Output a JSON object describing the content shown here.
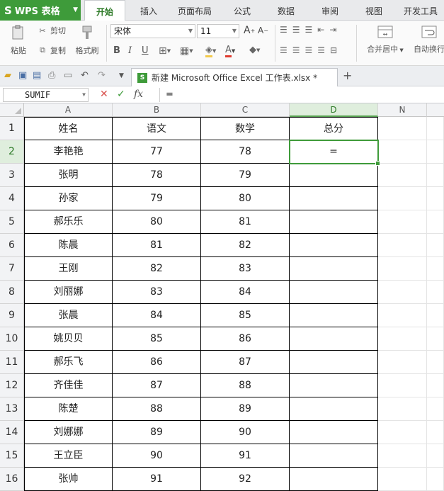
{
  "app": {
    "name": "WPS 表格",
    "logo": "S"
  },
  "tabs": [
    "开始",
    "插入",
    "页面布局",
    "公式",
    "数据",
    "审阅",
    "视图",
    "开发工具"
  ],
  "active_tab": "开始",
  "ribbon": {
    "cut_label": "剪切",
    "copy_label": "复制",
    "paste_label": "粘贴",
    "format_painter_label": "格式刷",
    "font_name": "宋体",
    "font_size": "11",
    "merge_center_label": "合并居中",
    "wrap_text_label": "自动换行"
  },
  "document": {
    "tab_title": "新建 Microsoft Office Excel 工作表.xlsx *",
    "icon": "excel-icon"
  },
  "formula_bar": {
    "name_box": "SUMIF",
    "formula": "="
  },
  "columns": [
    "A",
    "B",
    "C",
    "D",
    "N"
  ],
  "selected_column": "D",
  "selected_row": 2,
  "sheet": {
    "headers": [
      "姓名",
      "语文",
      "数学",
      "总分"
    ],
    "rows": [
      {
        "row": 2,
        "name": "李艳艳",
        "chinese": "77",
        "math": "78",
        "total": "="
      },
      {
        "row": 3,
        "name": "张明",
        "chinese": "78",
        "math": "79",
        "total": ""
      },
      {
        "row": 4,
        "name": "孙家",
        "chinese": "79",
        "math": "80",
        "total": ""
      },
      {
        "row": 5,
        "name": "郝乐乐",
        "chinese": "80",
        "math": "81",
        "total": ""
      },
      {
        "row": 6,
        "name": "陈晨",
        "chinese": "81",
        "math": "82",
        "total": ""
      },
      {
        "row": 7,
        "name": "王刚",
        "chinese": "82",
        "math": "83",
        "total": ""
      },
      {
        "row": 8,
        "name": "刘丽娜",
        "chinese": "83",
        "math": "84",
        "total": ""
      },
      {
        "row": 9,
        "name": "张晨",
        "chinese": "84",
        "math": "85",
        "total": ""
      },
      {
        "row": 10,
        "name": "姚贝贝",
        "chinese": "85",
        "math": "86",
        "total": ""
      },
      {
        "row": 11,
        "name": "郝乐飞",
        "chinese": "86",
        "math": "87",
        "total": ""
      },
      {
        "row": 12,
        "name": "齐佳佳",
        "chinese": "87",
        "math": "88",
        "total": ""
      },
      {
        "row": 13,
        "name": "陈楚",
        "chinese": "88",
        "math": "89",
        "total": ""
      },
      {
        "row": 14,
        "name": "刘娜娜",
        "chinese": "89",
        "math": "90",
        "total": ""
      },
      {
        "row": 15,
        "name": "王立臣",
        "chinese": "90",
        "math": "91",
        "total": ""
      },
      {
        "row": 16,
        "name": "张帅",
        "chinese": "91",
        "math": "92",
        "total": ""
      }
    ]
  },
  "colors": {
    "accent": "#3e9b3a",
    "selected_header": "#dfeedd"
  }
}
